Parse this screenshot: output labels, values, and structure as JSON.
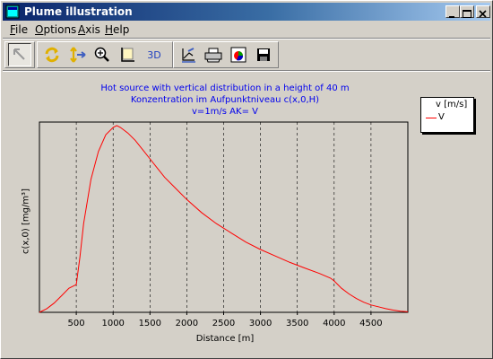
{
  "window": {
    "title": "Plume illustration"
  },
  "menu": {
    "items": [
      {
        "label": "File",
        "underline": "F",
        "rest": "ile"
      },
      {
        "label": "Options",
        "underline": "O",
        "rest": "ptions"
      },
      {
        "label": "Axis",
        "underline": "A",
        "rest": "xis"
      },
      {
        "label": "Help",
        "underline": "H",
        "rest": "elp"
      }
    ]
  },
  "toolbar": {
    "three_d_label": "3D"
  },
  "colors": {
    "title_blue": "#0000ee",
    "curve": "#ff0000"
  },
  "chart_data": {
    "type": "line",
    "title": [
      "Hot source with vertical distribution in a height of 40 m",
      "Konzentration im Aufpunktniveau c(x,0,H)",
      "v=1m/s AK= V"
    ],
    "xlabel": "Distance [m]",
    "ylabel": "c(x,0) [mg/m³]",
    "xlim": [
      0,
      5000
    ],
    "ylim": [
      0,
      1
    ],
    "xticks": [
      500,
      1000,
      1500,
      2000,
      2500,
      3000,
      3500,
      4000,
      4500
    ],
    "xgrid": "dashed vertical",
    "legend": {
      "position": "top-right",
      "title": "v [m/s]",
      "entries": [
        "V"
      ]
    },
    "series": [
      {
        "name": "V",
        "x": [
          0,
          100,
          200,
          300,
          400,
          500,
          550,
          600,
          700,
          800,
          900,
          1000,
          1050,
          1100,
          1200,
          1300,
          1400,
          1500,
          1600,
          1700,
          1800,
          1900,
          2000,
          2200,
          2400,
          2600,
          2800,
          3000,
          3200,
          3400,
          3600,
          3800,
          3950,
          4000,
          4100,
          4200,
          4300,
          4400,
          4500,
          4600,
          4700,
          4800,
          4900,
          5000
        ],
        "values": [
          0.0,
          0.02,
          0.05,
          0.09,
          0.13,
          0.15,
          0.3,
          0.48,
          0.72,
          0.87,
          0.96,
          1.0,
          1.01,
          1.0,
          0.97,
          0.93,
          0.88,
          0.83,
          0.78,
          0.73,
          0.69,
          0.65,
          0.61,
          0.54,
          0.48,
          0.43,
          0.38,
          0.34,
          0.305,
          0.27,
          0.24,
          0.21,
          0.185,
          0.17,
          0.13,
          0.1,
          0.075,
          0.055,
          0.04,
          0.03,
          0.02,
          0.012,
          0.006,
          0.003
        ]
      }
    ]
  }
}
